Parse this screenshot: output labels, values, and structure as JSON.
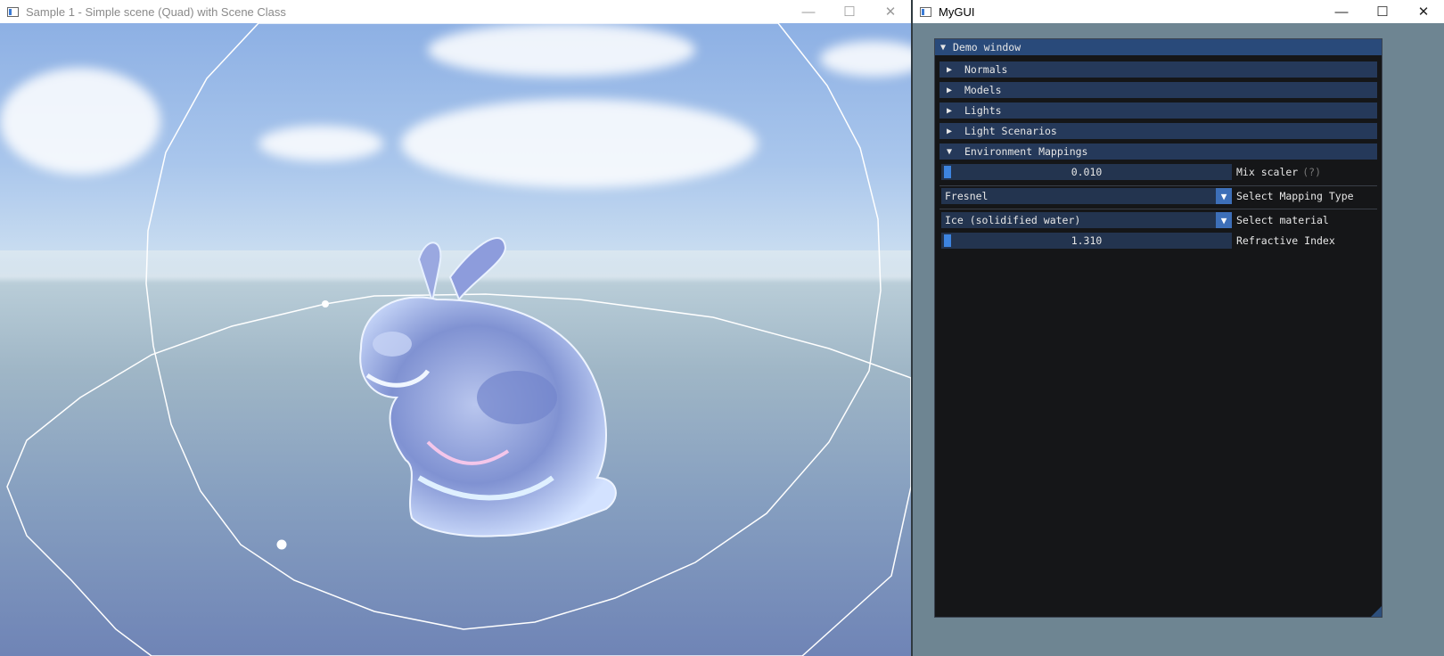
{
  "left_window": {
    "title": "Sample 1 - Simple scene (Quad) with Scene Class",
    "controls": [
      "—",
      "☐",
      "✕"
    ]
  },
  "right_window": {
    "title": "MyGUI",
    "controls": [
      "—",
      "☐",
      "✕"
    ]
  },
  "imgui": {
    "window_title": "Demo window",
    "headers": [
      {
        "label": "Normals",
        "open": false
      },
      {
        "label": "Models",
        "open": false
      },
      {
        "label": "Lights",
        "open": false
      },
      {
        "label": "Light Scenarios",
        "open": false
      },
      {
        "label": "Environment Mappings",
        "open": true
      }
    ],
    "mix_scaler": {
      "value": "0.010",
      "label": "Mix scaler",
      "hint": "(?)"
    },
    "mapping_type": {
      "value": "Fresnel",
      "label": "Select Mapping Type"
    },
    "material": {
      "value": "Ice (solidified water)",
      "label": "Select material"
    },
    "refractive_index": {
      "value": "1.310",
      "label": "Refractive Index"
    }
  },
  "colors": {
    "imgui_bg": "#151618",
    "title_bg": "#294a7a",
    "header_bg": "#25395a",
    "frame_bg": "#23344f",
    "accent": "#3d84e0"
  }
}
